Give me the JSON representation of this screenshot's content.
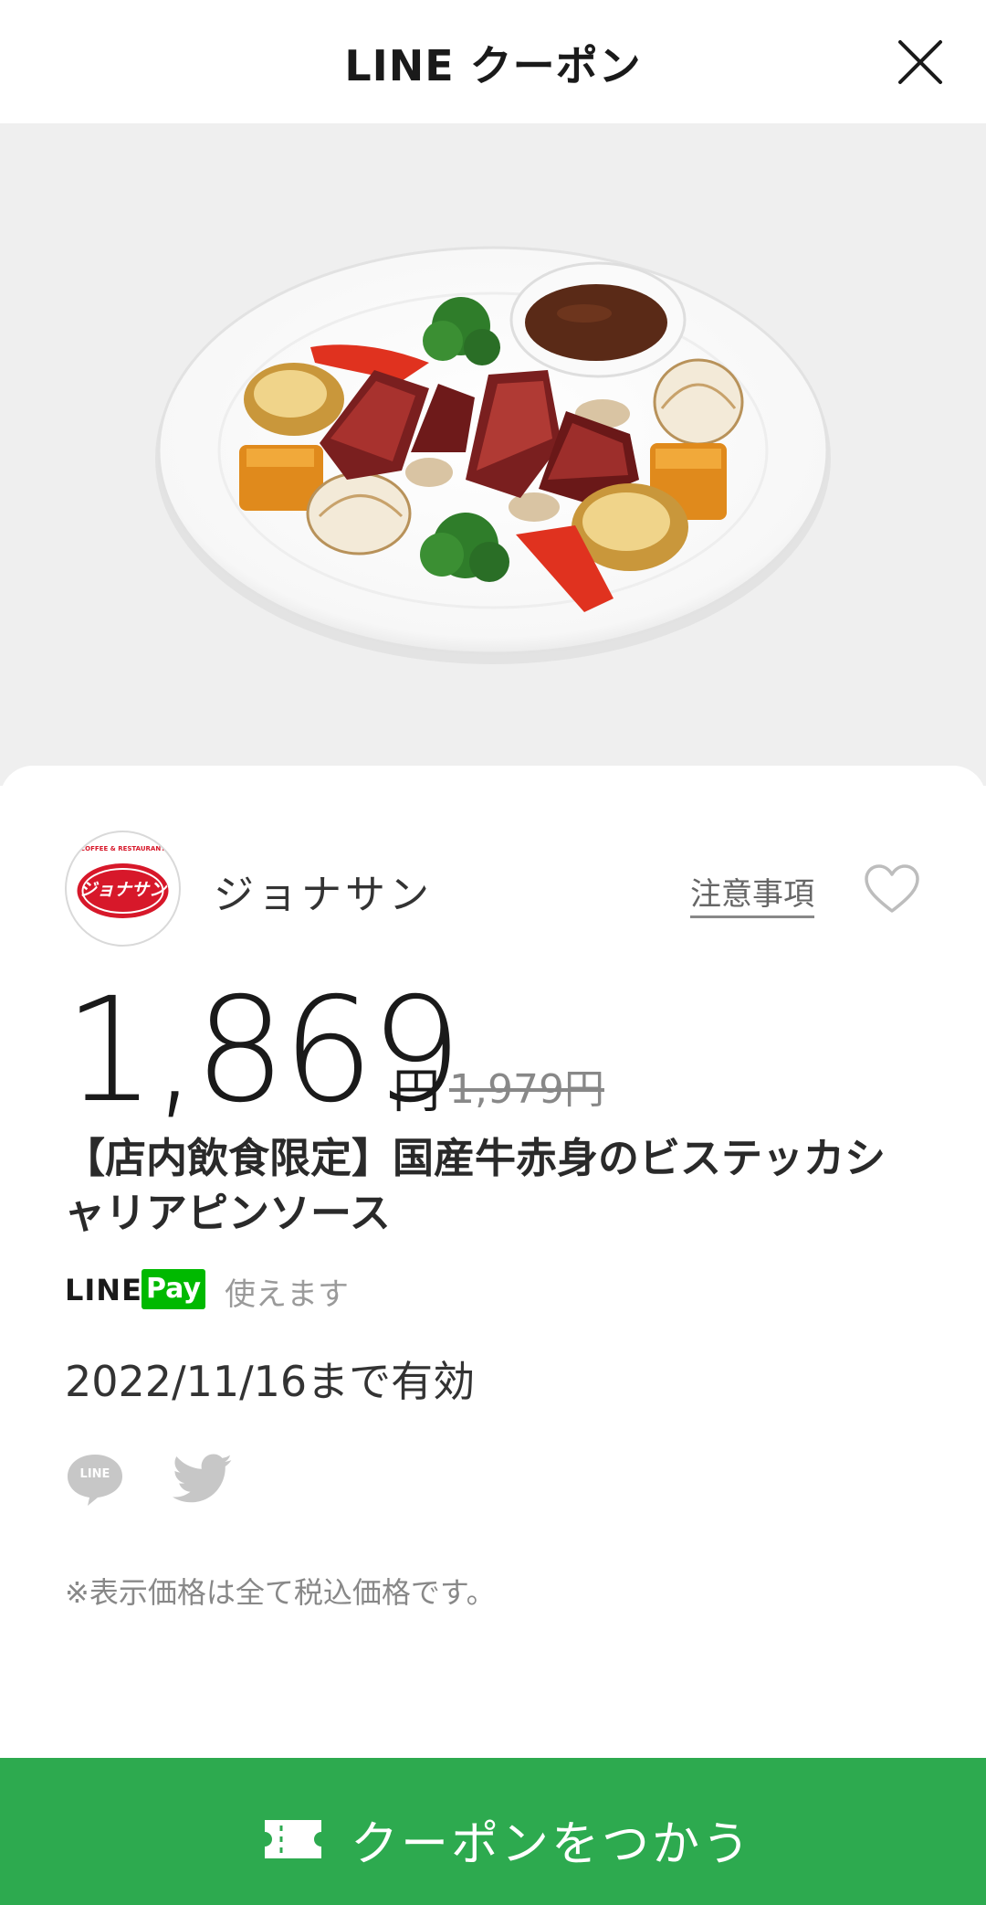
{
  "header": {
    "title": "LINE クーポン"
  },
  "hero": {
    "image": "plate-of-steak-with-vegetables"
  },
  "shop": {
    "name": "ジョナサン",
    "logo_text_top": "COFFEE & RESTAURANT",
    "logo_text_main": "ジョナサン",
    "notes_label": "注意事項"
  },
  "offer": {
    "price": "1,869",
    "yen": "円",
    "original_price": "1,979円",
    "title": "【店内飲食限定】国産牛赤身のビステッカシャリアピンソース"
  },
  "payment": {
    "line_word": "LINE",
    "pay_badge": "Pay",
    "note": "使えます"
  },
  "validity": "2022/11/16まで有効",
  "share": {
    "line_icon_text": "LINE"
  },
  "disclaimer": "※表示価格は全て税込価格です。",
  "cta": {
    "label": "クーポンをつかう"
  },
  "colors": {
    "accent_green": "#2daa4f",
    "line_green": "#00b900",
    "logo_red": "#d7182a"
  }
}
